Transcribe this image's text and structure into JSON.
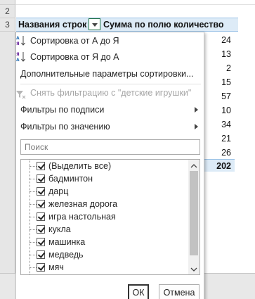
{
  "sheet": {
    "row_numbers": [
      "2",
      "3"
    ],
    "header": {
      "col_a": "Названия строк",
      "col_b": "Сумма по полю количество"
    },
    "values": [
      "24",
      "13",
      "2",
      "15",
      "57",
      "10",
      "34",
      "21",
      "26"
    ],
    "total": "202"
  },
  "menu": {
    "sort_az": "Сортировка от А до Я",
    "sort_za": "Сортировка от Я до А",
    "more_sort": "Дополнительные параметры сортировки...",
    "clear_filter": "Снять фильтрацию с \"детские игрушки\"",
    "label_filters": "Фильтры по подписи",
    "value_filters": "Фильтры по значению",
    "search_placeholder": "Поиск",
    "items": [
      "(Выделить все)",
      "бадминтон",
      "дарц",
      "железная дорога",
      "игра настольная",
      "кукла",
      "машинка",
      "медведь",
      "мяч"
    ],
    "ok": "ОК",
    "cancel": "Отмена"
  },
  "colors": {
    "header_fill": "#ddebf7",
    "accent_green": "#217346"
  }
}
